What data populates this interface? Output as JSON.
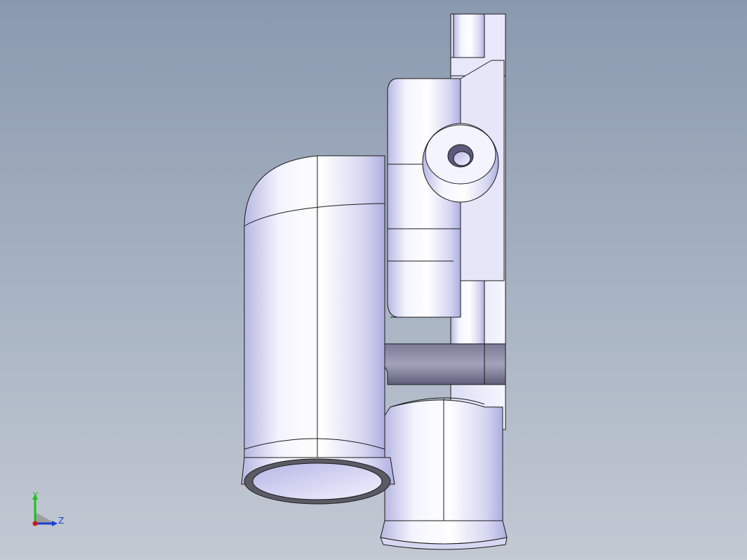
{
  "viewport": {
    "background_top": "#8a99ae",
    "background_bottom": "#c3c9d3"
  },
  "model": {
    "shade_light": "#f4f4ff",
    "shade_mid": "#c9c9ee",
    "shade_dark": "#6e6e8c",
    "edge_color": "#1a1a1a"
  },
  "triad": {
    "y_label": "Y",
    "z_label": "Z",
    "y_color": "#19c219",
    "z_color": "#1a3fd6",
    "x_color": "#d01818"
  }
}
